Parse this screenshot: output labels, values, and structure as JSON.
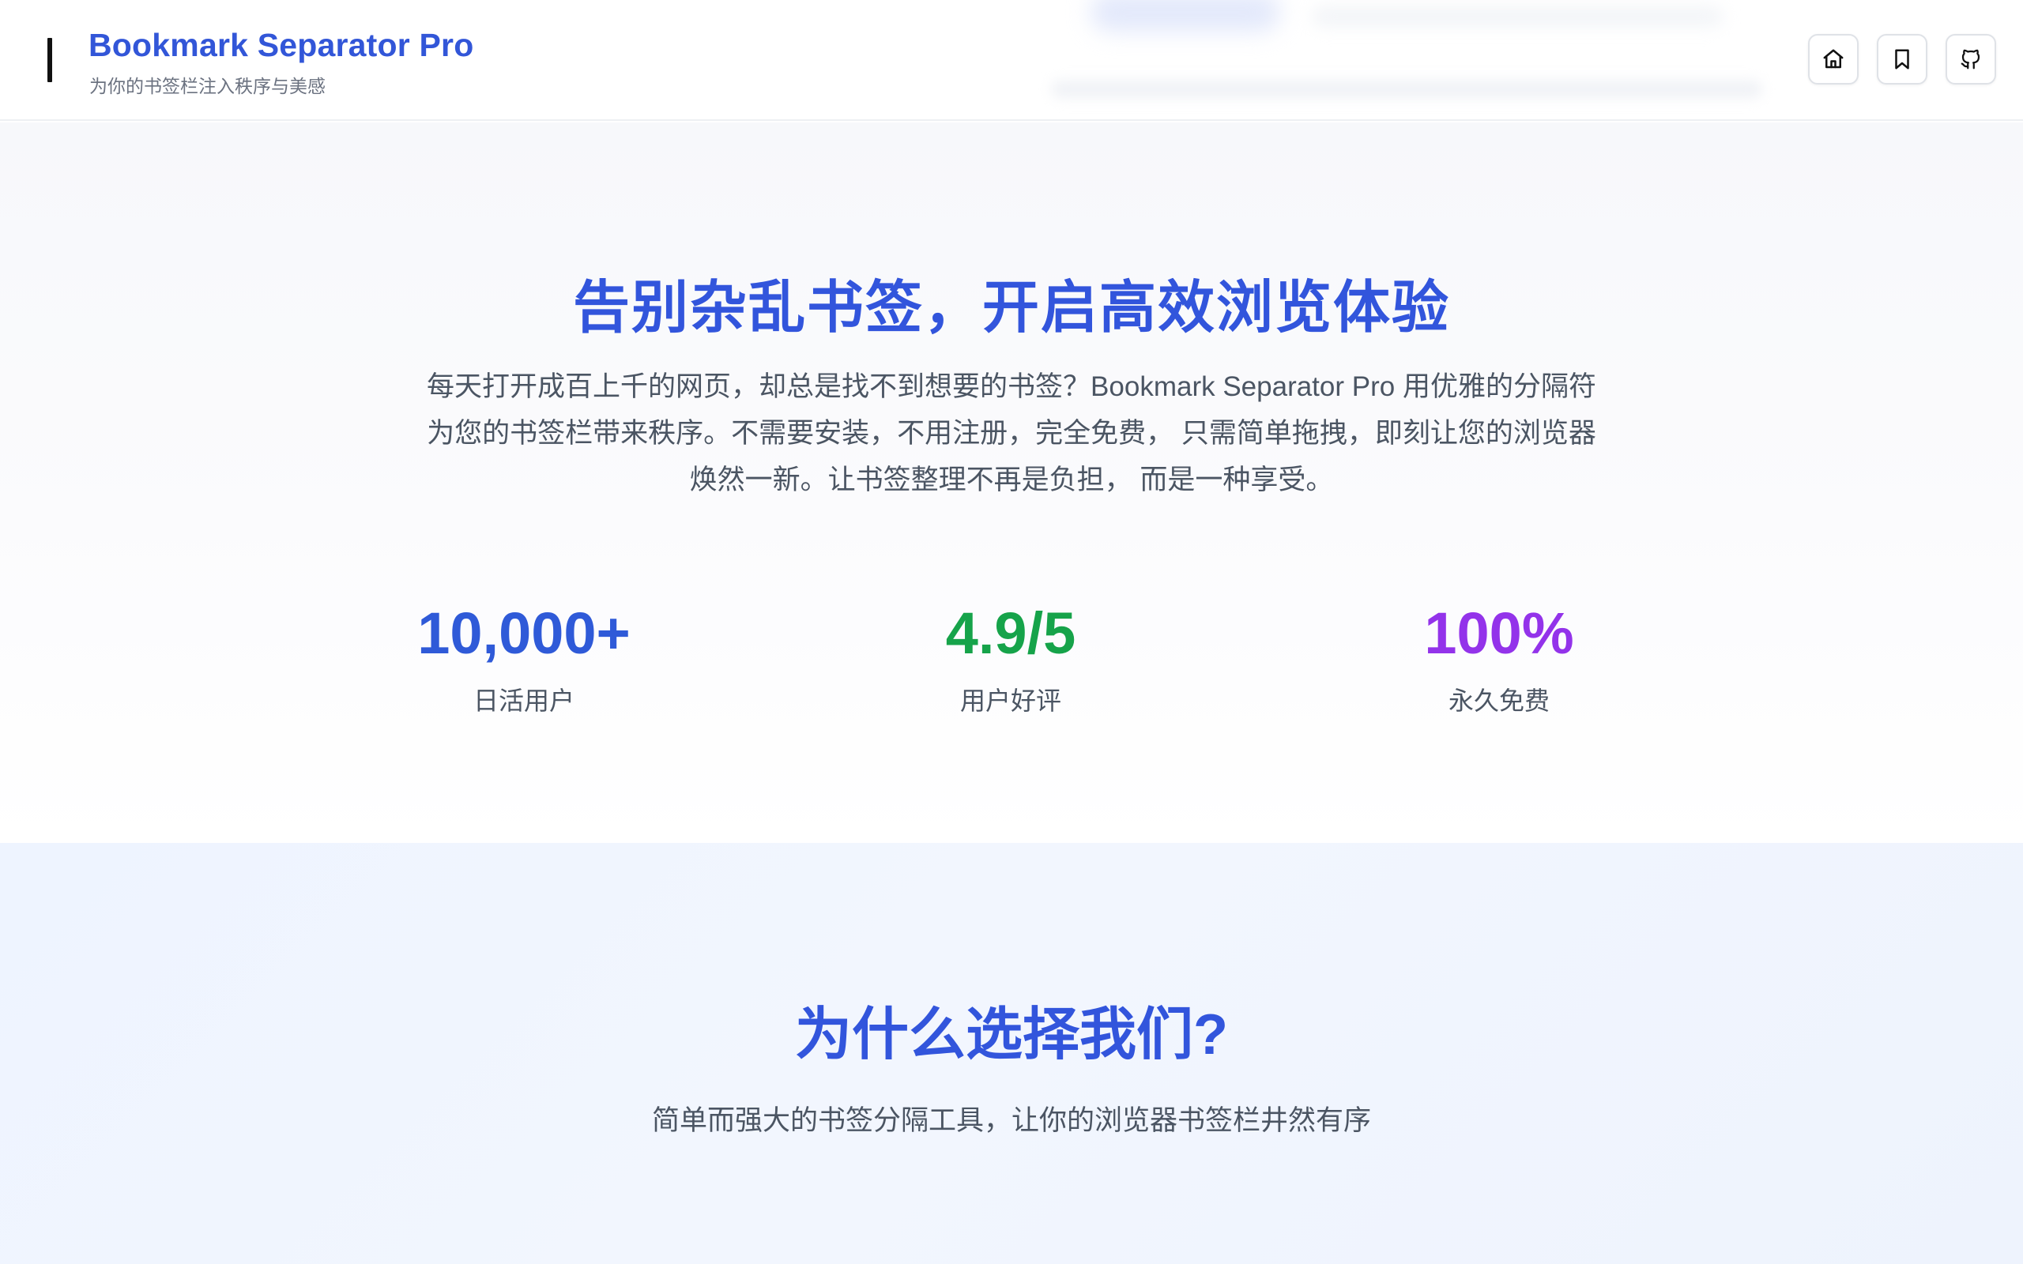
{
  "header": {
    "title": "Bookmark Separator Pro",
    "subtitle": "为你的书签栏注入秩序与美感",
    "icons": [
      "home-icon",
      "bookmark-icon",
      "github-icon"
    ]
  },
  "hero": {
    "title": "告别杂乱书签，开启高效浏览体验",
    "description_lines": [
      "每天打开成百上千的网页，却总是找不到想要的书签？Bookmark Separator Pro 用优雅的分隔符",
      "为您的书签栏带来秩序。不需要安装，不用注册，完全免费， 只需简单拖拽，即刻让您的浏览器",
      "焕然一新。让书签整理不再是负担， 而是一种享受。"
    ],
    "stats": [
      {
        "value": "10,000+",
        "label": "日活用户",
        "color": "#2f5ad8"
      },
      {
        "value": "4.9/5",
        "label": "用户好评",
        "color": "#16a34a"
      },
      {
        "value": "100%",
        "label": "永久免费",
        "color": "#9333ea"
      }
    ]
  },
  "why": {
    "title": "为什么选择我们?",
    "subtitle": "简单而强大的书签分隔工具，让你的浏览器书签栏井然有序"
  },
  "colors": {
    "accent": "#3255dc",
    "text_muted": "#4b5563"
  }
}
